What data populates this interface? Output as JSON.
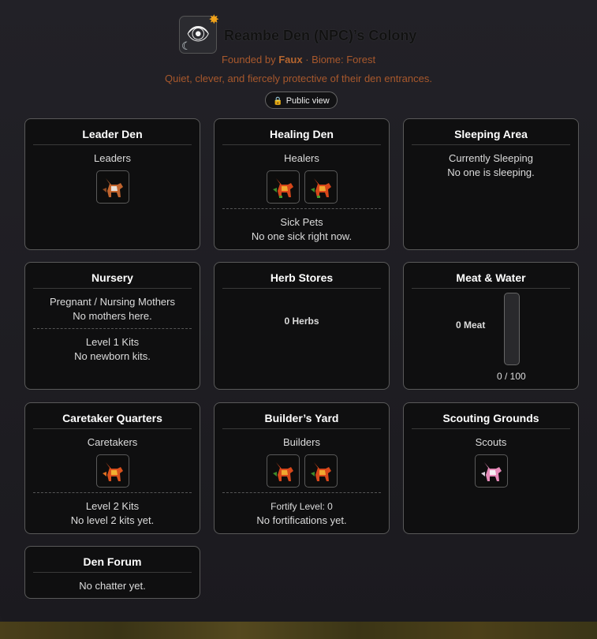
{
  "header": {
    "title": "Reambe Den (NPC)’s Colony",
    "founded_prefix": "Founded by",
    "founder": "Faux",
    "biome": "· Biome: Forest",
    "tagline": "Quiet, clever, and fiercely protective of their den entrances.",
    "public_view": "Public view"
  },
  "leader_den": {
    "title": "Leader Den",
    "label": "Leaders"
  },
  "healing_den": {
    "title": "Healing Den",
    "label": "Healers",
    "sick_label": "Sick Pets",
    "sick_empty": "No one sick right now."
  },
  "sleeping_area": {
    "title": "Sleeping Area",
    "label": "Currently Sleeping",
    "empty": "No one is sleeping."
  },
  "nursery": {
    "title": "Nursery",
    "mothers_label": "Pregnant / Nursing Mothers",
    "mothers_empty": "No mothers here.",
    "kits_label": "Level 1 Kits",
    "kits_empty": "No newborn kits."
  },
  "herb_stores": {
    "title": "Herb Stores",
    "count": "0 Herbs"
  },
  "meat_water": {
    "title": "Meat & Water",
    "meat": "0 Meat",
    "capacity": "0 / 100",
    "fill_fraction": 0
  },
  "caretaker": {
    "title": "Caretaker Quarters",
    "label": "Caretakers",
    "kits_label": "Level 2 Kits",
    "kits_empty": "No level 2 kits yet."
  },
  "builders_yard": {
    "title": "Builder’s Yard",
    "label": "Builders",
    "fortify": "Fortify Level: 0",
    "fortify_empty": "No fortifications yet."
  },
  "scouting": {
    "title": "Scouting Grounds",
    "label": "Scouts"
  },
  "den_forum": {
    "title": "Den Forum",
    "empty": "No chatter yet."
  },
  "colors": {
    "accent": "#a8582c",
    "lock": "#e8a22e"
  },
  "icons": {
    "logo": "eye-icon",
    "lock": "lock-icon",
    "pet": "fox-icon"
  }
}
